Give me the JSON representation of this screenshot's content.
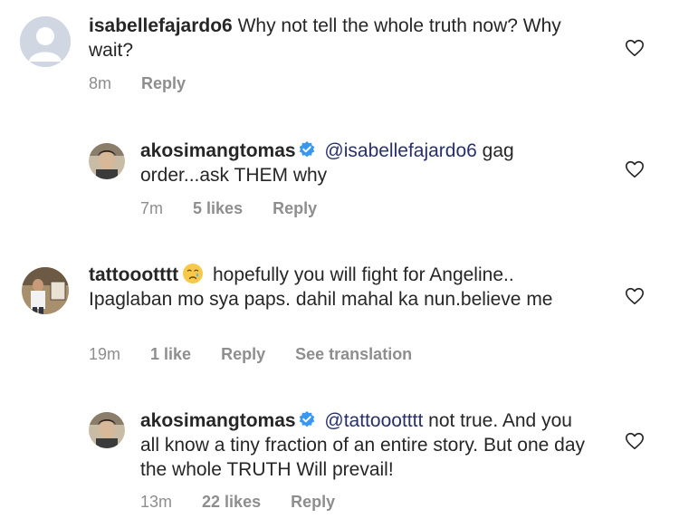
{
  "comments": [
    {
      "username": "isabellefajardo6",
      "text": "Why not tell the whole truth now? Why wait?",
      "time": "8m",
      "reply": "Reply"
    },
    {
      "username": "akosimangtomas",
      "mention": "@isabellefajardo6",
      "text": "gag order...ask THEM why",
      "time": "7m",
      "likes": "5 likes",
      "reply": "Reply"
    },
    {
      "username": "tattoootttt",
      "text": "hopefully you will fight for Angeline.. Ipaglaban mo sya paps. dahil mahal ka nun.believe me",
      "time": "19m",
      "likes": "1 like",
      "reply": "Reply",
      "translation": "See translation"
    },
    {
      "username": "akosimangtomas",
      "mention": "@tattoootttt",
      "text": "not true. And you all know a tiny fraction of an entire story. But one day the whole TRUTH Will prevail!",
      "time": "13m",
      "likes": "22 likes",
      "reply": "Reply"
    }
  ],
  "icons": {
    "heart": "heart-icon",
    "verified": "verified-badge-icon",
    "emoji": "crying-face-emoji",
    "avatar_default": "default-avatar-icon"
  },
  "colors": {
    "text": "#262626",
    "meta": "#8e8e8e",
    "mention": "#27306b",
    "verified": "#3897f0"
  }
}
